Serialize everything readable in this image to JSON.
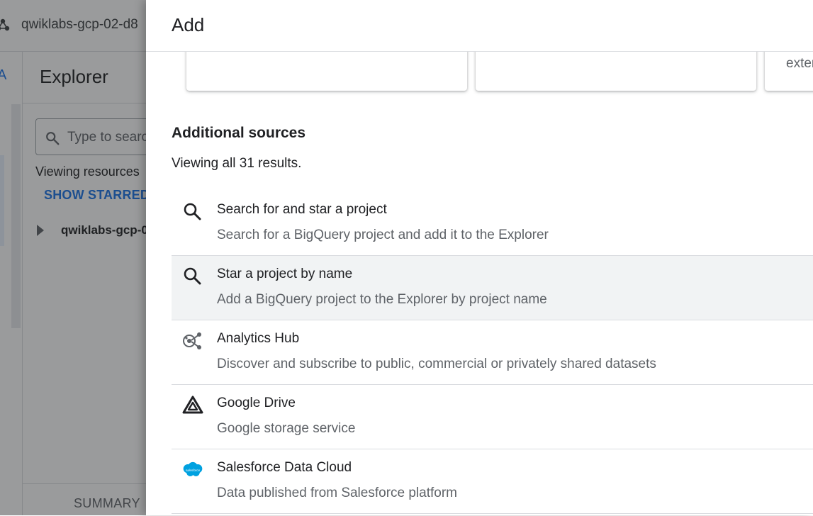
{
  "background": {
    "project_name": "qwiklabs-gcp-02-d8",
    "rail_letter": "A",
    "explorer_title": "Explorer",
    "search_placeholder": "Type to search",
    "viewing_resources": "Viewing resources",
    "show_starred": "SHOW STARRED",
    "tree_project": "qwiklabs-gcp-0",
    "bottom_tab": "SUMMARY"
  },
  "panel": {
    "title": "Add",
    "cards": [
      {
        "text": ""
      },
      {
        "text": ""
      },
      {
        "text": "exter"
      }
    ],
    "section_title": "Additional sources",
    "results_count": "Viewing all 31 results.",
    "items": [
      {
        "icon": "search-icon",
        "title": "Search for and star a project",
        "description": "Search for a BigQuery project and add it to the Explorer"
      },
      {
        "icon": "search-icon",
        "title": "Star a project by name",
        "description": "Add a BigQuery project to the Explorer by project name"
      },
      {
        "icon": "analytics-hub-icon",
        "title": "Analytics Hub",
        "description": "Discover and subscribe to public, commercial or privately shared datasets"
      },
      {
        "icon": "google-drive-icon",
        "title": "Google Drive",
        "description": "Google storage service"
      },
      {
        "icon": "salesforce-icon",
        "icon_text": "salesforce",
        "title": "Salesforce Data Cloud",
        "description": "Data published from Salesforce platform"
      }
    ]
  },
  "colors": {
    "accent": "#1a73e8",
    "hover_row": "#f1f3f4",
    "salesforce": "#00a1e0",
    "scrim": "#202124"
  }
}
